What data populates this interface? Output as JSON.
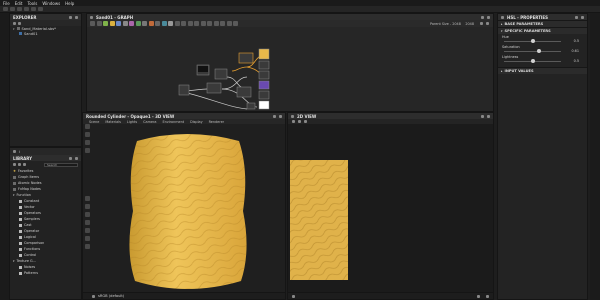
{
  "menu": [
    "File",
    "Edit",
    "Tools",
    "Windows",
    "Help"
  ],
  "explorer": {
    "title": "EXPLORER",
    "file": "Sand_Material.sbs*",
    "graph": "Sand01"
  },
  "graph_panel": {
    "title": "Sand01 - GRAPH",
    "zoom_text": "Parent Size - 2048",
    "size_text": "2048"
  },
  "library": {
    "title": "LIBRARY",
    "search_placeholder": "Search",
    "categories": [
      "Favorites",
      "Graph Items",
      "Atomic Nodes",
      "FxMap Nodes"
    ],
    "function_header": "Function",
    "function_items": [
      "Constant",
      "Vector",
      "Operators",
      "Samplers",
      "Cast",
      "Operator",
      "Logical",
      "Comparison",
      "Functions",
      "Control"
    ],
    "texture_header": "Texture G...",
    "texture_items": [
      "Noises",
      "Patterns"
    ]
  },
  "view3d": {
    "title": "Rounded Cylinder - Opaque1 - 3D VIEW",
    "tabs": [
      "Scene",
      "Materials",
      "Lights",
      "Camera",
      "Environment",
      "Display",
      "Renderer"
    ],
    "bottom_label": "sRGB (default)"
  },
  "view2d": {
    "title": "2D VIEW"
  },
  "properties": {
    "title": "HSL - PROPERTIES",
    "base_section": "BASE PARAMETERS",
    "specific_section": "SPECIFIC PARAMETERS",
    "params": [
      {
        "label": "Hue",
        "value": "0.5",
        "fraction": 0.5
      },
      {
        "label": "Saturation",
        "value": "0.61",
        "fraction": 0.61
      },
      {
        "label": "Lightness",
        "value": "0.5",
        "fraction": 0.5
      }
    ],
    "input_section": "INPUT VALUES"
  },
  "colors": {
    "sand": "#e8b84a",
    "sand_dark": "#c9952c",
    "accent": "#3f6fa6"
  }
}
